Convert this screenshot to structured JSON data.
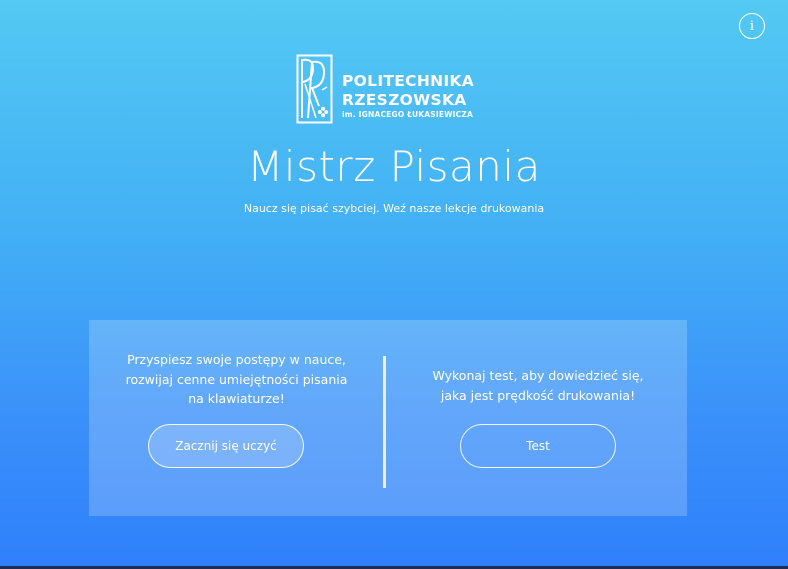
{
  "header": {
    "info_icon_glyph": "i"
  },
  "logo": {
    "line1": "POLITECHNIKA",
    "line2": "RZESZOWSKA",
    "line3": "im. IGNACEGO ŁUKASIEWICZA"
  },
  "hero": {
    "title": "Mistrz Pisania",
    "subtitle": "Naucz się pisać szybciej. Weź nasze lekcje drukowania"
  },
  "panel": {
    "left": {
      "text_lines": [
        "Przyspiesz swoje postępy w nauce,",
        "rozwijaj cenne umiejętności pisania",
        "na klawiaturze!"
      ],
      "button_label": "Zacznij się uczyć"
    },
    "right": {
      "text_lines": [
        "Wykonaj test, aby dowiedzieć się,",
        "jaka jest prędkość drukowania!"
      ],
      "button_label": "Test"
    }
  },
  "colors": {
    "gradient_top": "#53c9f3",
    "gradient_bottom": "#2f80fb",
    "text": "#ffffff"
  }
}
